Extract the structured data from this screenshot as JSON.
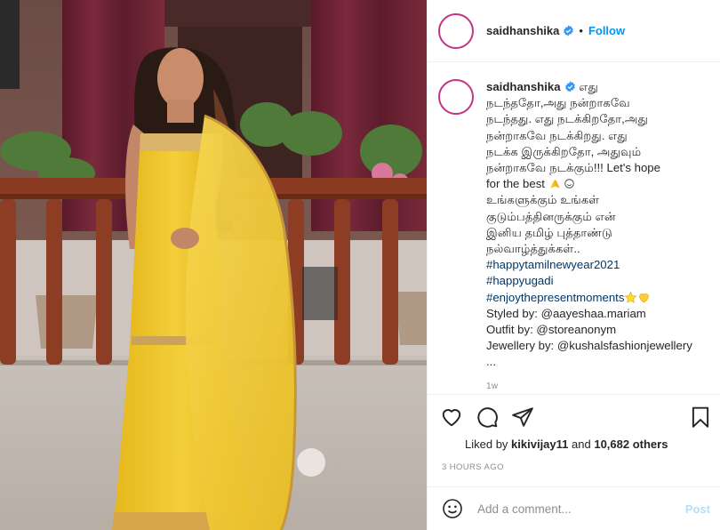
{
  "post": {
    "username": "saidhanshika",
    "separator": "•",
    "follow_label": "Follow",
    "caption_username": "saidhanshika",
    "caption_lines": [
      "நடந்ததோ,அது நன்றாகவே",
      "நடந்தது. எது நடக்கிறதோ,அது",
      "நன்றாகவே நடக்கிறது. எது",
      "நடக்க இருக்கிறதோ, அதுவும்",
      "நன்றாகவே நடக்கும்!!! Let's hope",
      "for the best",
      "உங்களுக்கும் உங்கள்",
      "குடும்பத்தினருக்கும் என்",
      "இனிய தமிழ் புத்தாண்டு",
      "நல்வாழ்த்துக்கள்..",
      "#happytamilnewyear2021",
      "#happyugadi",
      "#enjoythepresentmoments",
      "Styled by: @aayeshaa.mariam",
      "Outfit by: @storeanonym",
      "Jewellery by: @kushalsfashionjewellery",
      "..."
    ],
    "caption_first_word": "எது",
    "caption_age": "1w",
    "likes": {
      "prefix": "Liked by",
      "user": "kikivijay11",
      "conjunction": "and",
      "count": "10,682 others"
    },
    "posted_time": "3 HOURS AGO",
    "comment_placeholder": "Add a comment...",
    "post_button": "Post"
  },
  "icons": {
    "verified": "verified-badge-icon",
    "like": "heart-icon",
    "comment": "comment-icon",
    "share": "share-icon",
    "save": "bookmark-icon",
    "emoji": "emoji-icon"
  },
  "colors": {
    "accent": "#0095f6",
    "post_disabled": "#b2dffc",
    "muted": "#8e8e8e",
    "text": "#262626"
  }
}
